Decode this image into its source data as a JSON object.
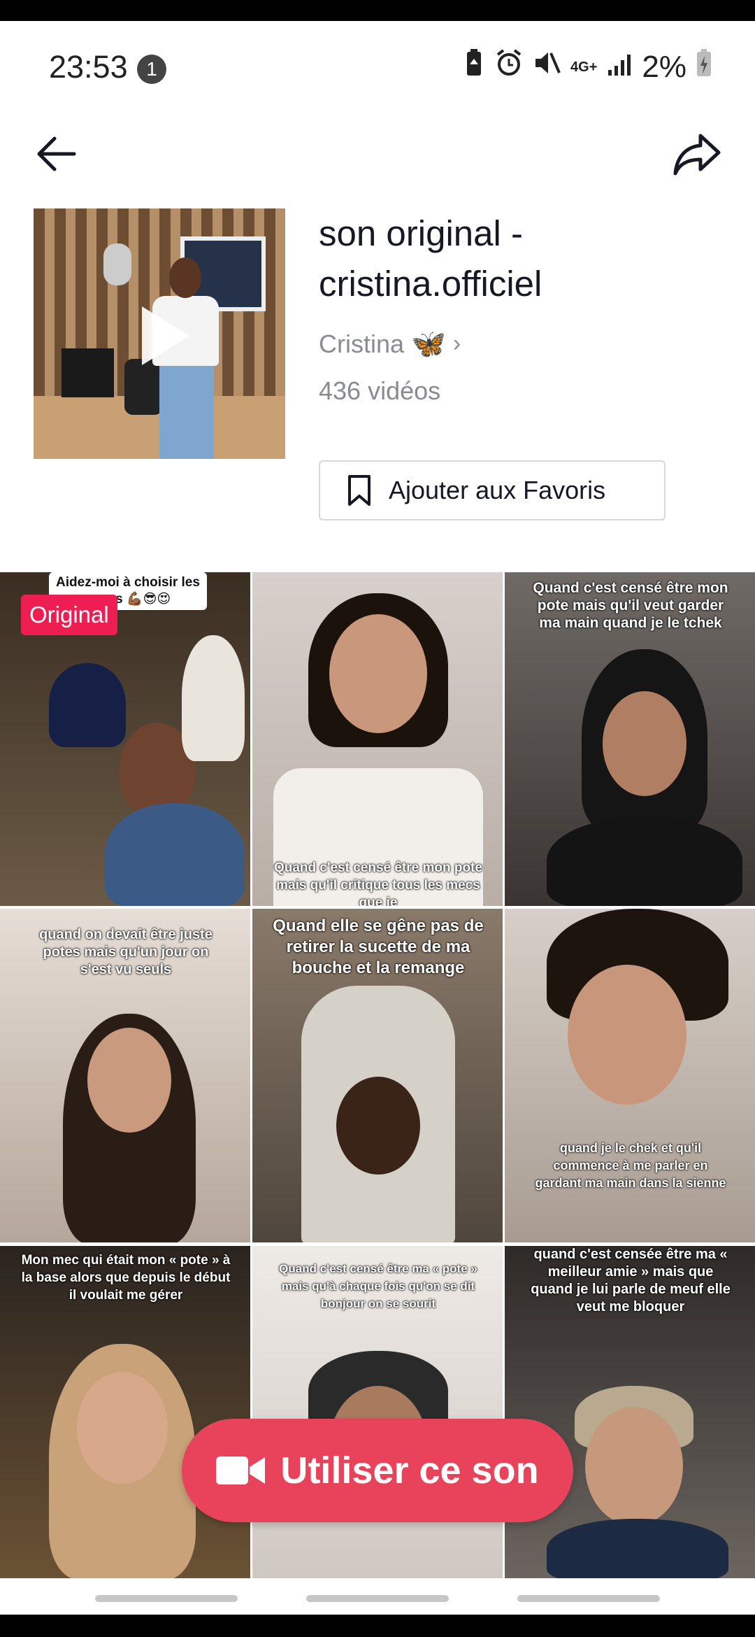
{
  "status_bar": {
    "time": "23:53",
    "notification_count": "1",
    "network": "4G+",
    "battery": "2%"
  },
  "sound": {
    "title": "son original - cristina.officiel",
    "author": "Cristina",
    "author_emoji": "🦋",
    "video_count": "436 vidéos",
    "favorite_label": "Ajouter aux Favoris"
  },
  "grid": {
    "original_badge": "Original",
    "tiles": [
      {
        "caption": "Aidez-moi à choisir les ... sus 💪🏾😎😍"
      },
      {
        "caption": "Quand c'est censé être mon pote mais qu'il critique tous les mecs que je"
      },
      {
        "caption": "Quand c'est censé être mon pote mais qu'il veut garder ma main quand je le tchek"
      },
      {
        "caption": "quand on devait être juste potes mais qu'un jour on s'est vu seuls"
      },
      {
        "caption": "Quand elle se gêne pas de retirer la sucette de ma bouche et la remange"
      },
      {
        "caption": "quand je le chek et qu'il commence à me parler en gardant ma main dans la sienne"
      },
      {
        "caption": "Mon mec qui était mon « pote » à la base alors que depuis le début il voulait me gérer"
      },
      {
        "caption": "Quand c'est censé être ma « pote » mais qu'à chaque fois qu'on se dit bonjour on se sourit"
      },
      {
        "caption": "quand c'est censée être ma « meilleur amie » mais que quand je lui parle de meuf elle veut me bloquer"
      }
    ]
  },
  "use_sound_label": "Utiliser ce son",
  "colors": {
    "accent": "#ee1d52",
    "use_button": "#e8435a",
    "secondary_text": "#8a8b91"
  }
}
